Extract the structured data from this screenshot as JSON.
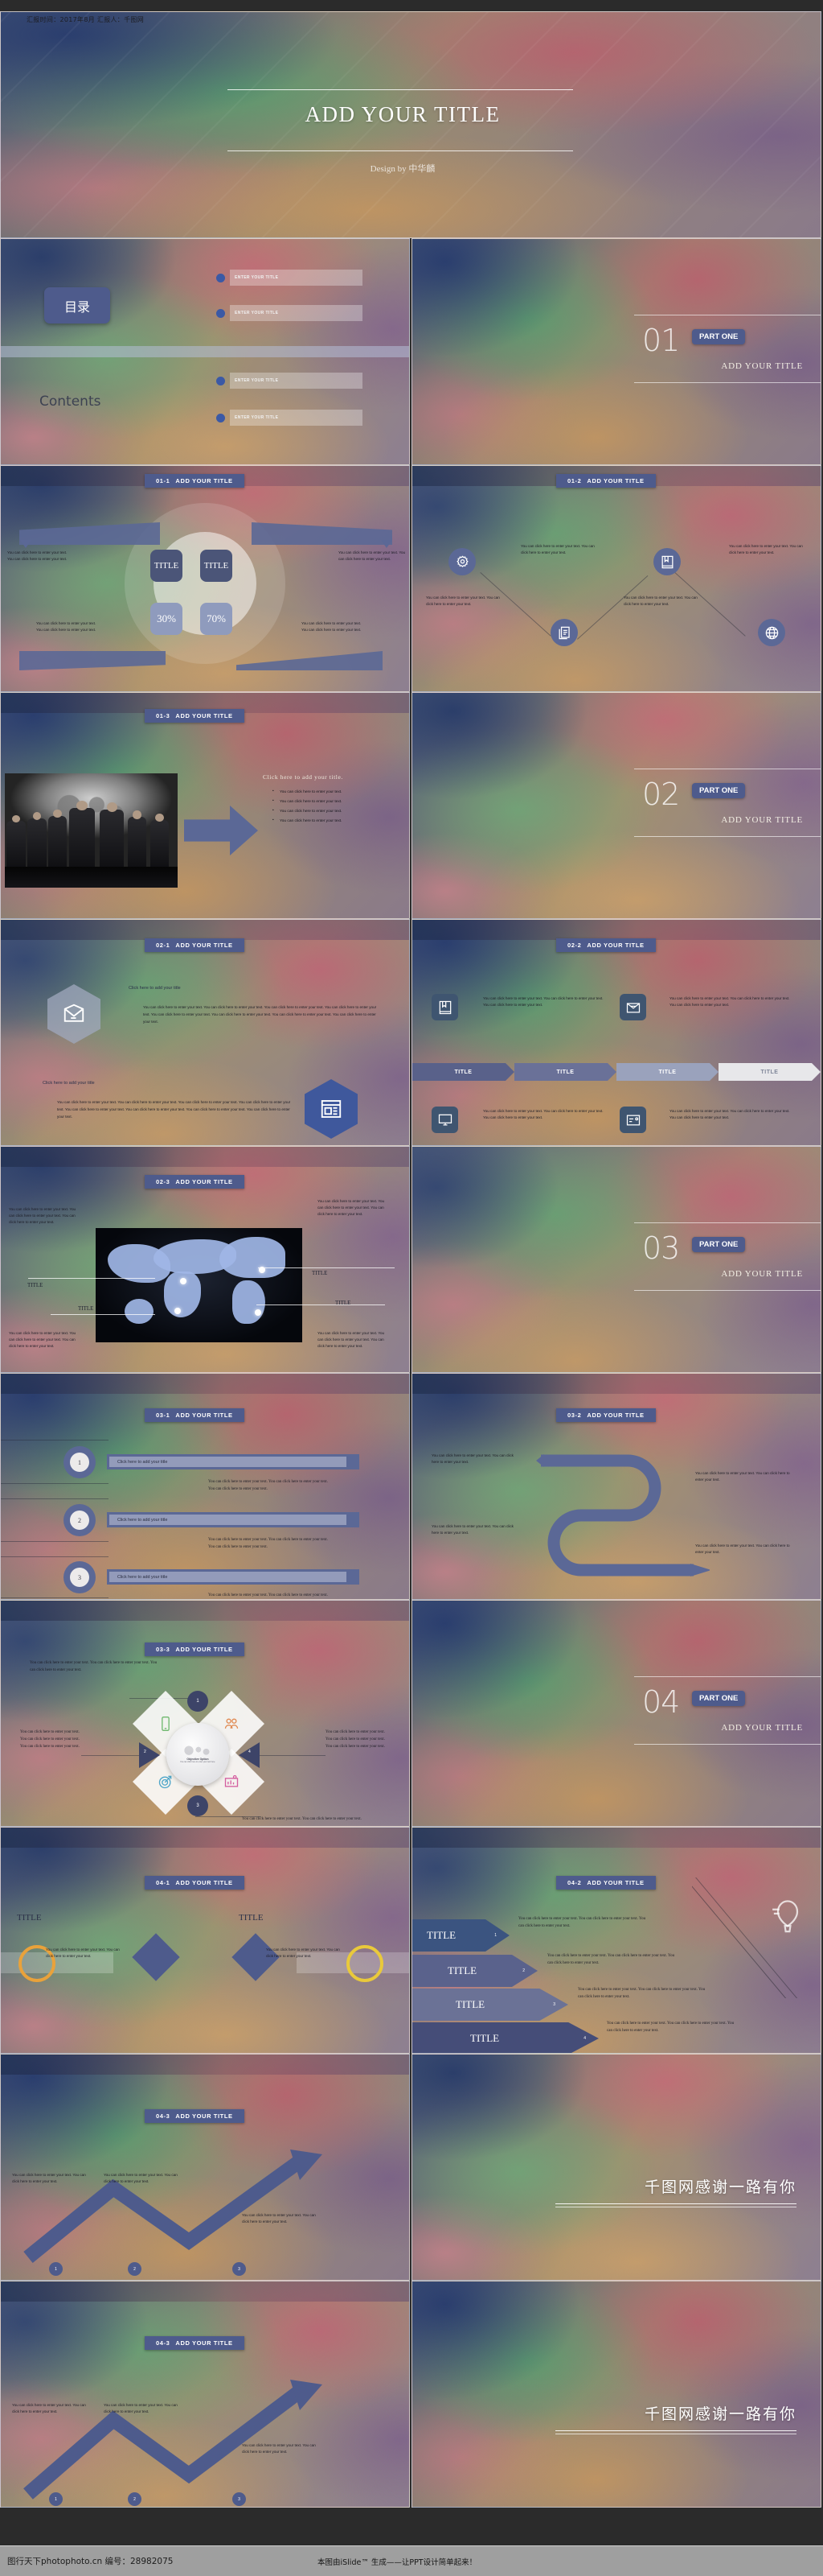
{
  "header": {
    "meta": "汇报时间：2017年8月    汇报人：千图网"
  },
  "title_slide": {
    "title": "ADD YOUR TITLE",
    "subtitle": "Design by 中华麟"
  },
  "toc": {
    "badge": "目录",
    "label": "Contents",
    "items": [
      "ENTER YOUR TITLE",
      "ENTER YOUR TITLE",
      "ENTER YOUR TITLE",
      "ENTER YOUR TITLE"
    ]
  },
  "sections": [
    {
      "num": "01",
      "part": "PART ONE",
      "title": "ADD YOUR TITLE"
    },
    {
      "num": "02",
      "part": "PART ONE",
      "title": "ADD YOUR TITLE"
    },
    {
      "num": "03",
      "part": "PART ONE",
      "title": "ADD YOUR TITLE"
    },
    {
      "num": "04",
      "part": "PART ONE",
      "title": "ADD YOUR TITLE"
    }
  ],
  "common": {
    "body": "You can click here to enter your text. You can click here to enter your text.",
    "body_short": "You can click here to enter your text.",
    "click_title": "Click here to add your title",
    "click_title_dot": "Click here to add your title.",
    "title_word": "TITLE",
    "add_your_title": "ADD YOUR TITLE"
  },
  "slides": {
    "s0101": {
      "num": "01-1",
      "title": "ADD YOUR TITLE",
      "q1": "TITLE",
      "q2": "TITLE",
      "q3": "30%",
      "q4": "70%",
      "tl": "You can click here to enter your text. You can click here to enter your text.",
      "tr": "You can click here to enter your text. You can click here to enter your text.",
      "bl": "You can click here to enter your text. You can click here to enter your text.",
      "br": "You can click here to enter your text. You can click here to enter your text."
    },
    "s0102": {
      "num": "01-2",
      "title": "ADD YOUR TITLE",
      "t1": "You can click here to enter your text. You can click here to enter your text.",
      "t2": "You can click here to enter your text. You can click here to enter your text.",
      "t3": "You can click here to enter your text. You can click here to enter your text.",
      "t4": "You can click here to enter your text. You can click here to enter your text.",
      "icons": [
        "gear-icon",
        "documents-icon",
        "book-icon",
        "globe-icon"
      ]
    },
    "s0103": {
      "num": "01-3",
      "title": "ADD YOUR TITLE",
      "heading": "Click here to add your title.",
      "bullets": [
        "You can click here to enter your text.",
        "You can click here to enter your text.",
        "You can click here to enter your text.",
        "You can click here to enter your text."
      ]
    },
    "s0201": {
      "num": "02-1",
      "title": "ADD YOUR TITLE",
      "h1": "Click here to add your title",
      "p1": "You can click here to enter your text. You can click here to enter your text. You can click here to enter your text. You can click here to enter your text. You can click here to enter your text. You can click here to enter your text. You can click here to enter your text. You can click here to enter your text.",
      "h2": "Click here to add your title",
      "p2": "You can click here to enter your text. You can click here to enter your text. You can click here to enter your text. You can click here to enter your text. You can click here to enter your text. You can click here to enter your text. You can click here to enter your text. You can click here to enter your text.",
      "icons": [
        "mail-open-icon",
        "browser-window-icon"
      ]
    },
    "s0202": {
      "num": "02-2",
      "title": "ADD YOUR TITLE",
      "t1": "You can click here to enter your text. You can click here to enter your text. You can click here to enter your text.",
      "t2": "You can click here to enter your text. You can click here to enter your text. You can click here to enter your text.",
      "t3": "You can click here to enter your text. You can click here to enter your text. You can click here to enter your text.",
      "t4": "You can click here to enter your text. You can click here to enter your text. You can click here to enter your text.",
      "chevrons": [
        "TITLE",
        "TITLE",
        "TITLE",
        "TITLE"
      ],
      "icons": [
        "book-icon",
        "envelope-icon",
        "monitor-icon",
        "id-card-icon"
      ]
    },
    "s0203": {
      "num": "02-3",
      "title": "ADD YOUR TITLE",
      "labels": [
        "TITLE",
        "TITLE",
        "TITLE",
        "TITLE"
      ],
      "tl": "You can click here to enter your text. You can click here to enter your text. You can click here to enter your text.",
      "tr": "You can click here to enter your text. You can click here to enter your text. You can click here to enter your text.",
      "bl": "You can click here to enter your text. You can click here to enter your text. You can click here to enter your text.",
      "br": "You can click here to enter your text. You can click here to enter your text. You can click here to enter your text."
    },
    "s0301": {
      "num": "03-1",
      "title": "ADD YOUR TITLE",
      "rows": [
        {
          "n": "1",
          "title": "Click here to add your title",
          "body": "You can click here to enter your text. You can click here to enter your text. You can click here to enter your text."
        },
        {
          "n": "2",
          "title": "Click here to add your title",
          "body": "You can click here to enter your text. You can click here to enter your text. You can click here to enter your text."
        },
        {
          "n": "3",
          "title": "Click here to add your title",
          "body": "You can click here to enter your text. You can click here to enter your text. You can click here to enter your text."
        }
      ]
    },
    "s0302": {
      "num": "03-2",
      "title": "ADD YOUR TITLE",
      "t1": "You can click here to enter your text. You can click here to enter your text.",
      "t2": "You can click here to enter your text. You can click here to enter your text.",
      "t3": "You can click here to enter your text. You can click here to enter your text.",
      "t4": "You can click here to enter your text. You can click here to enter your text."
    },
    "s0303": {
      "num": "03-3",
      "title": "ADD YOUR TITLE",
      "top": "You can click here to enter your text. You can click here to enter your text. You can click here to enter your text.",
      "left": "You can click here to enter your text. You can click here to enter your text. You can click here to enter your text.",
      "right": "You can click here to enter your text. You can click here to enter your text. You can click here to enter your text.",
      "bottom": "You can click here to enter your text. You can click here to enter your text.",
      "nums": [
        "1",
        "2",
        "3",
        "4"
      ],
      "hub_title": "Objective Option",
      "hub_body": "You can click here to enter your text here.",
      "icons": [
        "mobile-icon",
        "people-icon",
        "target-icon",
        "chart-icon"
      ]
    },
    "s0401": {
      "num": "04-1",
      "title": "ADD YOUR TITLE",
      "l_title": "TITLE",
      "r_title": "TITLE",
      "l_body": "You can click here to enter your text. You can click here to enter your text.",
      "r_body": "You can click here to enter your text. You can click here to enter your text."
    },
    "s0402": {
      "num": "04-2",
      "title": "ADD YOUR TITLE",
      "rows": [
        {
          "label": "TITLE",
          "n": "1",
          "body": "You can click here to enter your text. You can click here to enter your text. You can click here to enter your text."
        },
        {
          "label": "TITLE",
          "n": "2",
          "body": "You can click here to enter your text. You can click here to enter your text. You can click here to enter your text."
        },
        {
          "label": "TITLE",
          "n": "3",
          "body": "You can click here to enter your text. You can click here to enter your text. You can click here to enter your text."
        },
        {
          "label": "TITLE",
          "n": "4",
          "body": "You can click here to enter your text. You can click here to enter your text. You can click here to enter your text."
        }
      ],
      "icon": "balloon-icon"
    },
    "s0403": {
      "num": "04-3",
      "title": "ADD YOUR TITLE",
      "t1": "You can click here to enter your text. You can click here to enter your text.",
      "t2": "You can click here to enter your text. You can click here to enter your text.",
      "t3": "You can click here to enter your text. You can click here to enter your text.",
      "nums": [
        "1",
        "2",
        "3"
      ]
    },
    "thanks": {
      "text": "千图网感谢一路有你"
    }
  },
  "footer": {
    "left": "图行天下photophoto.cn 编号：28982075",
    "mid": "本图由iSlide™ 生成——让PPT设计简单起来！"
  },
  "colors": {
    "accent": "#4e5b8c",
    "accent_light": "#8f9bbd",
    "badge": "#3b59a5"
  }
}
